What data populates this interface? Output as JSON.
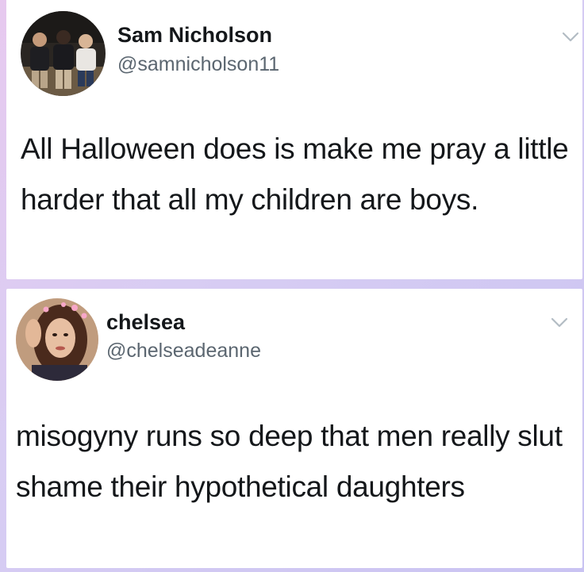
{
  "tweets": [
    {
      "name": "Sam Nicholson",
      "handle": "@samnicholson11",
      "text": "All Halloween does is make me pray a little harder that all my children are boys.",
      "avatar_icon": "group-photo-avatar",
      "menu_icon": "chevron-down-icon"
    },
    {
      "name": "chelsea",
      "handle": "@chelseadeanne",
      "text": "misogyny runs so deep that men really slut shame their hypothetical daughters",
      "avatar_icon": "selfie-avatar",
      "menu_icon": "chevron-down-icon"
    }
  ],
  "colors": {
    "background_gradient_start": "#e7c9ef",
    "background_gradient_end": "#c9c3f2",
    "card": "#ffffff",
    "name_text": "#14171a",
    "handle_text": "#5b6670"
  }
}
